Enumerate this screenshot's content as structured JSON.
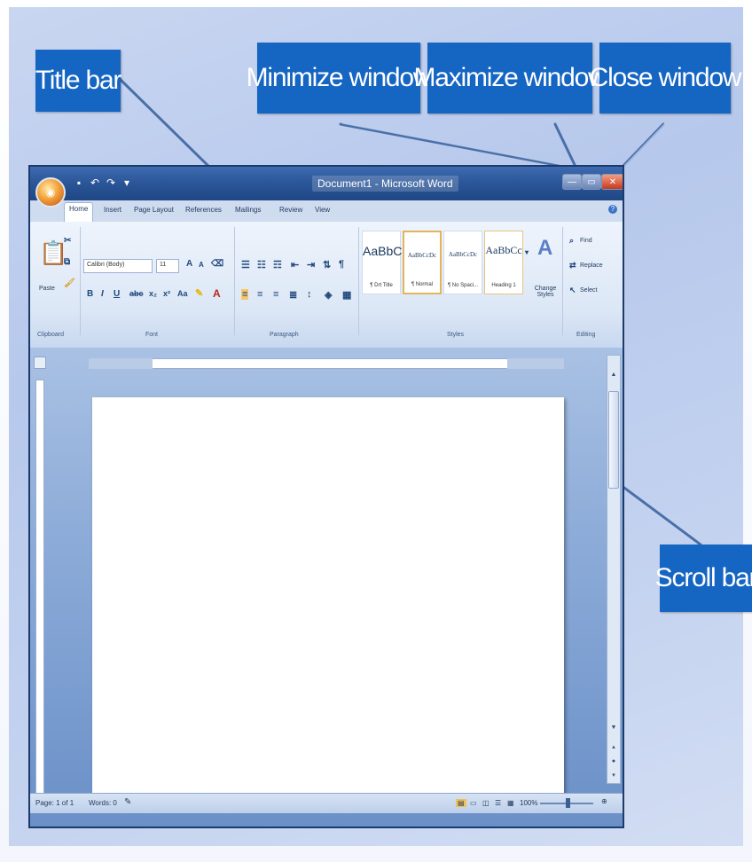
{
  "callouts": {
    "title_bar": "Title bar",
    "minimize": "Minimize window",
    "maximize": "Maximize window",
    "close": "Close window",
    "scroll_bar": "Scroll bar"
  },
  "window": {
    "title": "Document1 - Microsoft Word",
    "tabs": [
      "Home",
      "Insert",
      "Page Layout",
      "References",
      "Mailings",
      "Review",
      "View"
    ]
  },
  "ribbon": {
    "clipboard": {
      "paste_label": "Paste",
      "group": "Clipboard"
    },
    "font": {
      "name": "Calibri (Body)",
      "size": "11",
      "group": "Font"
    },
    "paragraph": {
      "group": "Paragraph"
    },
    "styles": {
      "group": "Styles",
      "items": [
        {
          "sample": "AaBbC",
          "name": "¶ Drt Title"
        },
        {
          "sample": "AaBbCcDc",
          "name": "¶ Normal"
        },
        {
          "sample": "AaBbCcDc",
          "name": "¶ No Spaci..."
        },
        {
          "sample": "AaBbCc",
          "name": "Heading 1"
        }
      ],
      "change_styles": "Change Styles"
    },
    "editing": {
      "group": "Editing",
      "find": "Find",
      "replace": "Replace",
      "select": "Select"
    }
  },
  "status": {
    "page": "Page: 1 of 1",
    "words": "Words: 0",
    "zoom": "100%"
  },
  "colors": {
    "callout_bg": "#1565c2",
    "title_bar": "#2a5597"
  }
}
